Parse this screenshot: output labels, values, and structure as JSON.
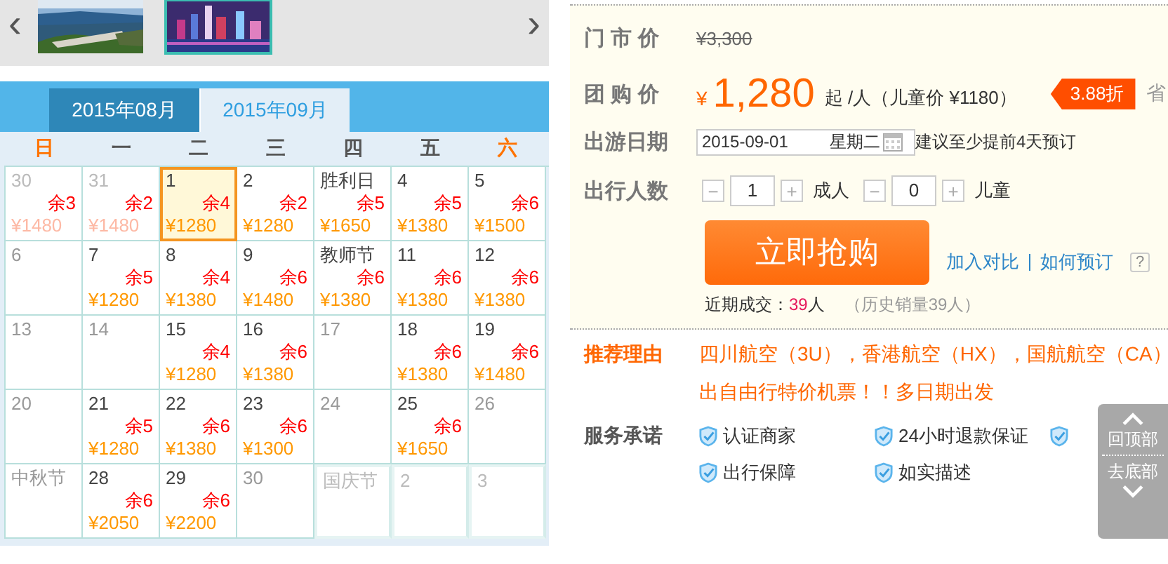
{
  "gallery": {
    "prev": "‹",
    "next": "›",
    "thumbs": [
      {
        "selected": false
      },
      {
        "selected": true
      }
    ]
  },
  "calendar": {
    "tabs": [
      {
        "label": "2015年08月",
        "selected": false
      },
      {
        "label": "2015年09月",
        "selected": true
      }
    ],
    "weekdays": [
      {
        "label": "日",
        "weekend": true
      },
      {
        "label": "一",
        "weekend": false
      },
      {
        "label": "二",
        "weekend": false
      },
      {
        "label": "三",
        "weekend": false
      },
      {
        "label": "四",
        "weekend": false
      },
      {
        "label": "五",
        "weekend": false
      },
      {
        "label": "六",
        "weekend": true
      }
    ],
    "cells": [
      {
        "label": "30",
        "kind": "prev",
        "remain": "余3",
        "price": "¥1480",
        "selected": false
      },
      {
        "label": "31",
        "kind": "prev",
        "remain": "余2",
        "price": "¥1480",
        "selected": false
      },
      {
        "label": "1",
        "kind": "day",
        "remain": "余4",
        "price": "¥1280",
        "selected": true
      },
      {
        "label": "2",
        "kind": "day",
        "remain": "余2",
        "price": "¥1280",
        "selected": false
      },
      {
        "label": "胜利日",
        "kind": "day",
        "remain": "余5",
        "price": "¥1650",
        "selected": false
      },
      {
        "label": "4",
        "kind": "day",
        "remain": "余5",
        "price": "¥1380",
        "selected": false
      },
      {
        "label": "5",
        "kind": "day",
        "remain": "余6",
        "price": "¥1500",
        "selected": false
      },
      {
        "label": "6",
        "kind": "day",
        "selected": false
      },
      {
        "label": "7",
        "kind": "day",
        "remain": "余5",
        "price": "¥1280",
        "selected": false
      },
      {
        "label": "8",
        "kind": "day",
        "remain": "余4",
        "price": "¥1380",
        "selected": false
      },
      {
        "label": "9",
        "kind": "day",
        "remain": "余6",
        "price": "¥1480",
        "selected": false
      },
      {
        "label": "教师节",
        "kind": "day",
        "remain": "余6",
        "price": "¥1380",
        "selected": false
      },
      {
        "label": "11",
        "kind": "day",
        "remain": "余6",
        "price": "¥1380",
        "selected": false
      },
      {
        "label": "12",
        "kind": "day",
        "remain": "余6",
        "price": "¥1380",
        "selected": false
      },
      {
        "label": "13",
        "kind": "day",
        "selected": false
      },
      {
        "label": "14",
        "kind": "day",
        "selected": false
      },
      {
        "label": "15",
        "kind": "day",
        "remain": "余4",
        "price": "¥1280",
        "selected": false
      },
      {
        "label": "16",
        "kind": "day",
        "remain": "余6",
        "price": "¥1380",
        "selected": false
      },
      {
        "label": "17",
        "kind": "day",
        "selected": false
      },
      {
        "label": "18",
        "kind": "day",
        "remain": "余6",
        "price": "¥1380",
        "selected": false
      },
      {
        "label": "19",
        "kind": "day",
        "remain": "余6",
        "price": "¥1480",
        "selected": false
      },
      {
        "label": "20",
        "kind": "day",
        "selected": false
      },
      {
        "label": "21",
        "kind": "day",
        "remain": "余5",
        "price": "¥1280",
        "selected": false
      },
      {
        "label": "22",
        "kind": "day",
        "remain": "余6",
        "price": "¥1380",
        "selected": false
      },
      {
        "label": "23",
        "kind": "day",
        "remain": "余6",
        "price": "¥1300",
        "selected": false
      },
      {
        "label": "24",
        "kind": "day",
        "selected": false
      },
      {
        "label": "25",
        "kind": "day",
        "remain": "余6",
        "price": "¥1650",
        "selected": false
      },
      {
        "label": "26",
        "kind": "day",
        "selected": false
      },
      {
        "label": "中秋节",
        "kind": "day",
        "selected": false
      },
      {
        "label": "28",
        "kind": "day",
        "remain": "余6",
        "price": "¥2050",
        "selected": false
      },
      {
        "label": "29",
        "kind": "day",
        "remain": "余6",
        "price": "¥2200",
        "selected": false
      },
      {
        "label": "30",
        "kind": "day",
        "selected": false
      },
      {
        "label": "国庆节",
        "kind": "next",
        "selected": false
      },
      {
        "label": "2",
        "kind": "next",
        "selected": false
      },
      {
        "label": "3",
        "kind": "next",
        "selected": false
      }
    ]
  },
  "market_price": {
    "label": "门 市 价",
    "value": "¥3,300"
  },
  "group_price": {
    "label": "团 购 价",
    "currency": "¥",
    "value": "1,280",
    "unit": "起 /人（儿童价 ¥1180）",
    "discount": "3.88折",
    "save": "省"
  },
  "travel_date": {
    "label": "出游日期",
    "date": "2015-09-01",
    "weekday": "星期二",
    "hint": "建议至少提前4天预订"
  },
  "travelers": {
    "label": "出行人数",
    "minus": "−",
    "plus": "+",
    "adult_count": "1",
    "adult_label": "成人",
    "child_count": "0",
    "child_label": "儿童"
  },
  "buy_button": "立即抢购",
  "links": [
    "加入对比",
    "如何预订"
  ],
  "help": "?",
  "sales": {
    "label": "近期成交：",
    "count": "39",
    "unit": "人",
    "history": "（历史销量39人）"
  },
  "reason": {
    "label": "推荐理由",
    "lines": [
      "四川航空（3U），香港航空（HX），国航航空（CA）",
      "出自由行特价机票！！多日期出发"
    ]
  },
  "service": {
    "label": "服务承诺",
    "items": [
      {
        "kind": "text",
        "label": "认证商家"
      },
      {
        "kind": "text",
        "label": "24小时退款保证"
      },
      {
        "kind": "icon"
      },
      {
        "kind": "text",
        "label": "出行保障"
      },
      {
        "kind": "text",
        "label": "如实描述"
      }
    ]
  },
  "float_nav": {
    "top": "回顶部",
    "bottom": "去底部"
  }
}
